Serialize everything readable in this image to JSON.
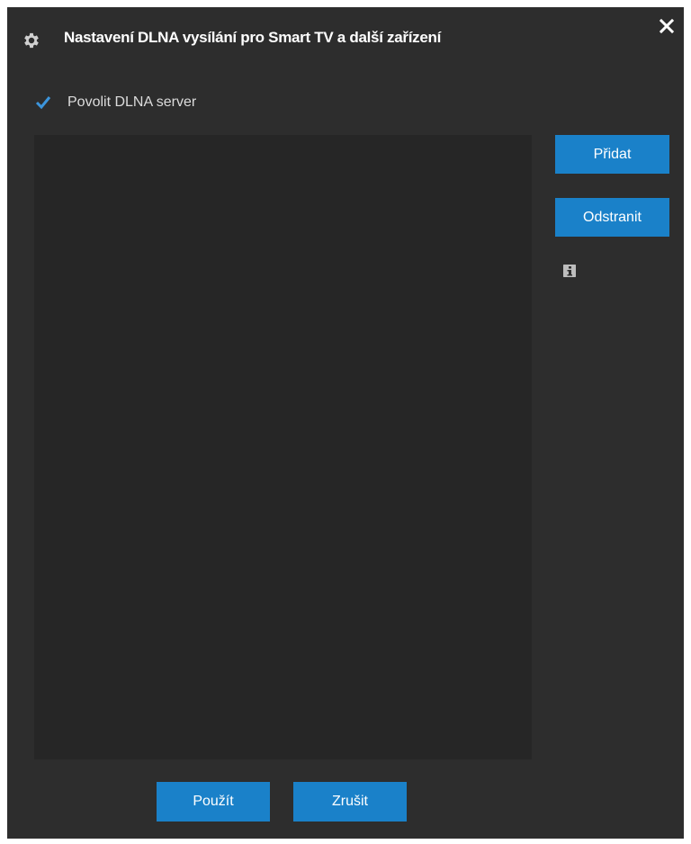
{
  "dialog": {
    "title": "Nastavení DLNA vysílání pro Smart TV a další zařízení",
    "title_icon": "gear-icon",
    "close_icon": "close-icon"
  },
  "enable_server": {
    "label": "Povolit DLNA server",
    "checked": true
  },
  "side_buttons": {
    "add_label": "Přidat",
    "remove_label": "Odstranit",
    "info_icon": "info-icon"
  },
  "footer": {
    "apply_label": "Použít",
    "cancel_label": "Zrušit"
  },
  "colors": {
    "background": "#2d2d2d",
    "list_background": "#262626",
    "accent": "#1a81c9",
    "text": "#ffffff"
  }
}
